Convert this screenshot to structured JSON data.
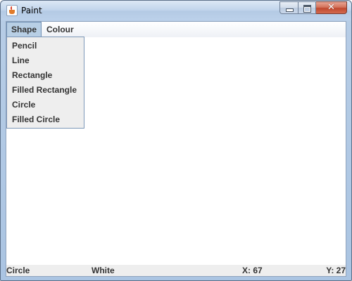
{
  "window": {
    "title": "Paint",
    "icon": "java-cup-icon",
    "controls": {
      "minimize": "minimize-icon",
      "maximize": "maximize-icon",
      "close": "close-icon",
      "close_glyph": "✕"
    }
  },
  "menubar": {
    "items": [
      {
        "label": "Shape",
        "active": true
      },
      {
        "label": "Colour",
        "active": false
      }
    ]
  },
  "shape_menu": {
    "items": [
      "Pencil",
      "Line",
      "Rectangle",
      "Filled Rectangle",
      "Circle",
      "Filled Circle"
    ]
  },
  "status": {
    "shape": "Circle",
    "colour": "White",
    "x": "X: 67",
    "y": "Y: 27"
  },
  "colors": {
    "menu_active_bg": "#b8cfe5",
    "menu_active_border": "#6f8fb3",
    "close_button": "#c0492f",
    "status_bg": "#eeeeee"
  }
}
